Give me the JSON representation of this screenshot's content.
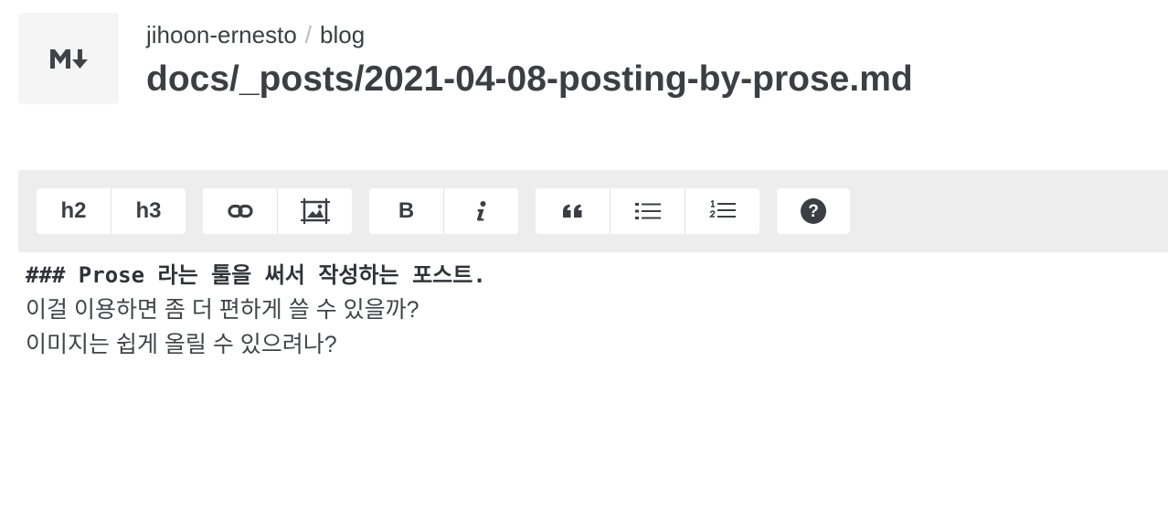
{
  "file_icon": "markdown-icon",
  "breadcrumb": {
    "owner": "jihoon-ernesto",
    "separator": "/",
    "repo": "blog"
  },
  "filename": "docs/_posts/2021-04-08-posting-by-prose.md",
  "toolbar": {
    "h2_label": "h2",
    "h3_label": "h3",
    "link_icon": "link-icon",
    "media_icon": "image-icon",
    "bold_label": "B",
    "italic_icon": "italic-icon",
    "quote_icon": "quote-icon",
    "bullet_list_icon": "bullet-list-icon",
    "numbered_list_icon": "numbered-list-icon",
    "help_icon": "help-icon"
  },
  "editor": {
    "heading": "### Prose 라는 툴을 써서 작성하는 포스트.",
    "lines": [
      "",
      "이걸 이용하면 좀 더 편하게 쓸 수 있을까?",
      "이미지는 쉽게 올릴 수 있으려나?"
    ]
  },
  "colors": {
    "text": "#3b3f44",
    "toolbar_bg": "#ededed",
    "button_bg": "#ffffff",
    "breadcrumb_separator": "#b8babc"
  }
}
